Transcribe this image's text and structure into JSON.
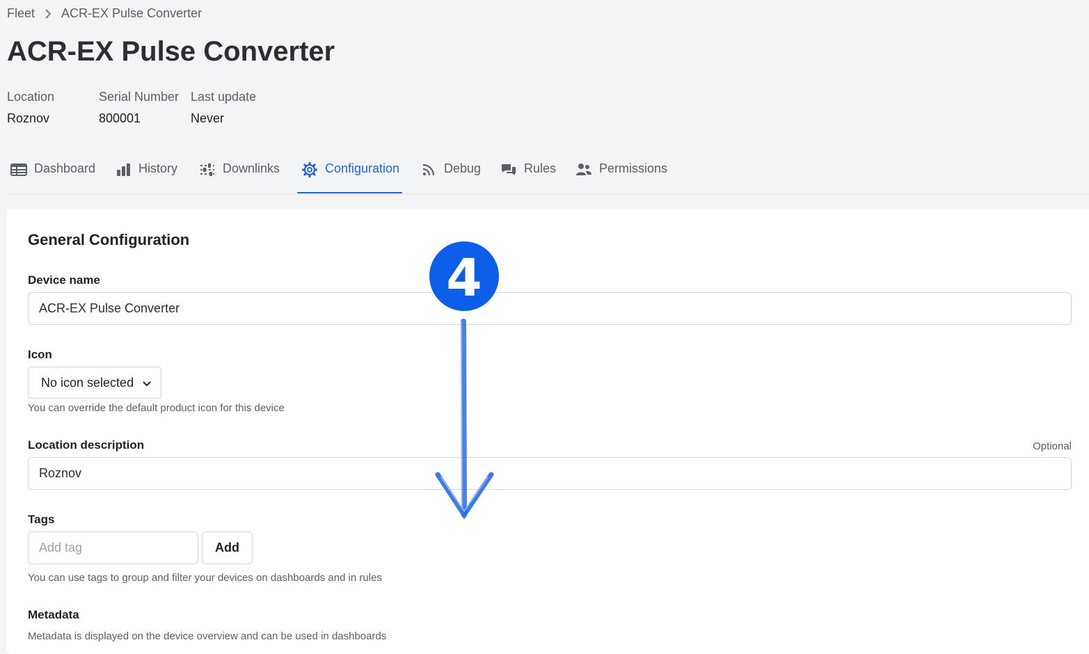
{
  "breadcrumb": {
    "parent": "Fleet",
    "current": "ACR-EX Pulse Converter"
  },
  "page_title": "ACR-EX Pulse Converter",
  "meta": {
    "location_label": "Location",
    "location_value": "Roznov",
    "serial_label": "Serial Number",
    "serial_value": "800001",
    "update_label": "Last update",
    "update_value": "Never"
  },
  "tabs": [
    {
      "label": "Dashboard",
      "icon": "table-icon"
    },
    {
      "label": "History",
      "icon": "bar-chart-icon"
    },
    {
      "label": "Downlinks",
      "icon": "sliders-icon"
    },
    {
      "label": "Configuration",
      "icon": "gear-icon",
      "active": true
    },
    {
      "label": "Debug",
      "icon": "rss-icon"
    },
    {
      "label": "Rules",
      "icon": "comments-icon"
    },
    {
      "label": "Permissions",
      "icon": "users-icon"
    }
  ],
  "config": {
    "title": "General Configuration",
    "device_name_label": "Device name",
    "device_name_value": "ACR-EX Pulse Converter",
    "icon_label": "Icon",
    "icon_select_value": "No icon selected",
    "icon_hint": "You can override the default product icon for this device",
    "location_label": "Location description",
    "location_optional": "Optional",
    "location_value": "Roznov",
    "tags_label": "Tags",
    "tags_placeholder": "Add tag",
    "tags_add": "Add",
    "tags_hint": "You can use tags to group and filter your devices on dashboards and in rules",
    "metadata_label": "Metadata",
    "metadata_hint": "Metadata is displayed on the device overview and can be used in dashboards"
  },
  "annotation": {
    "step": "4",
    "color": "#0b5ee8"
  },
  "colors": {
    "accent": "#2563d6",
    "background": "#f3f4f6"
  }
}
